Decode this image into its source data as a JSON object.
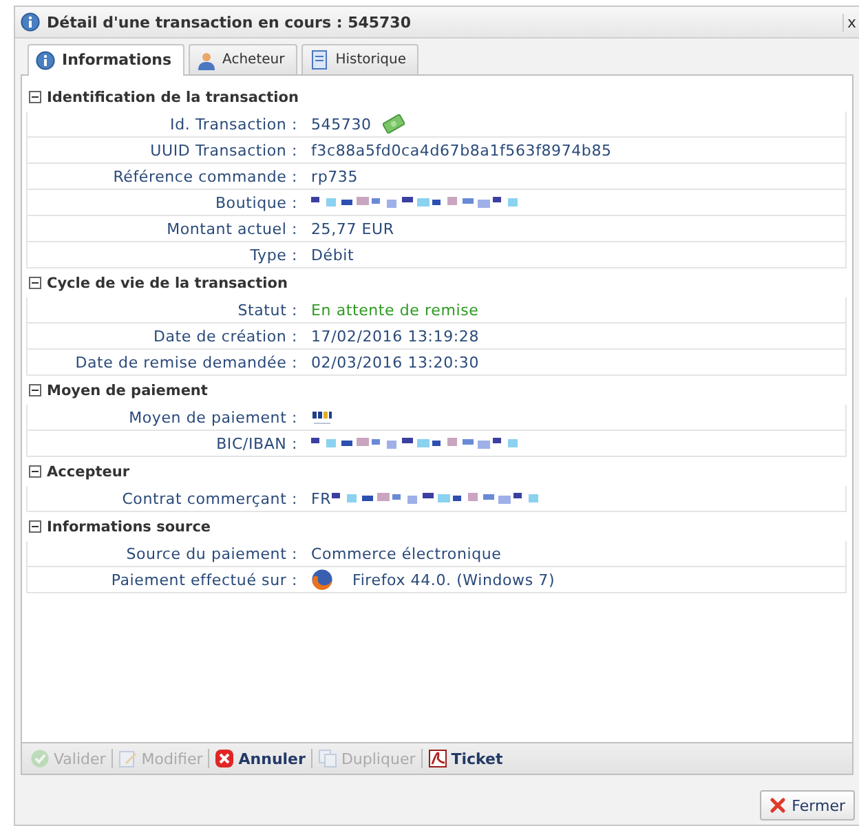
{
  "window": {
    "title": "Détail d'une transaction en cours : 545730",
    "close": "x"
  },
  "tabs": [
    {
      "label": "Informations",
      "selected": true
    },
    {
      "label": "Acheteur",
      "selected": false
    },
    {
      "label": "Historique",
      "selected": false
    }
  ],
  "sections": [
    {
      "title": "Identification de la transaction",
      "expanded": true,
      "rows": [
        {
          "label": "Id. Transaction :",
          "kind": "money",
          "value": "545730"
        },
        {
          "label": "UUID Transaction :",
          "kind": "text",
          "value": "f3c88a5fd0ca4d67b8a1f563f8974b85"
        },
        {
          "label": "Référence commande :",
          "kind": "text",
          "value": "rp735"
        },
        {
          "label": "Boutique :",
          "kind": "redacted"
        },
        {
          "label": "Montant actuel :",
          "kind": "text",
          "value": "25,77 EUR"
        },
        {
          "label": "Type :",
          "kind": "text",
          "value": "Débit"
        }
      ]
    },
    {
      "title": "Cycle de vie de la transaction",
      "expanded": true,
      "rows": [
        {
          "label": "Statut :",
          "kind": "status",
          "value": "En attente de remise"
        },
        {
          "label": "Date de création :",
          "kind": "text",
          "value": "17/02/2016 13:19:28"
        },
        {
          "label": "Date de remise demandée :",
          "kind": "text",
          "value": "02/03/2016 13:20:30"
        }
      ]
    },
    {
      "title": "Moyen de paiement",
      "expanded": true,
      "rows": [
        {
          "label": "Moyen de paiement :",
          "kind": "logo"
        },
        {
          "label": "BIC/IBAN :",
          "kind": "redacted"
        }
      ]
    },
    {
      "title": "Accepteur",
      "expanded": true,
      "rows": [
        {
          "label": "Contrat commerçant :",
          "kind": "redacted",
          "value": "FR"
        }
      ]
    },
    {
      "title": "Informations source",
      "expanded": true,
      "rows": [
        {
          "label": "Source du paiement :",
          "kind": "text",
          "value": "Commerce électronique"
        },
        {
          "label": "Paiement effectué sur :",
          "kind": "browser",
          "value": "Firefox 44.0. (Windows 7)"
        }
      ]
    }
  ],
  "toolbar": [
    {
      "label": "Valider",
      "disabled": true
    },
    {
      "label": "Modifier",
      "disabled": true
    },
    {
      "label": "Annuler",
      "disabled": false
    },
    {
      "label": "Dupliquer",
      "disabled": true
    },
    {
      "label": "Ticket",
      "disabled": false
    }
  ],
  "close_button": {
    "label": "Fermer"
  }
}
